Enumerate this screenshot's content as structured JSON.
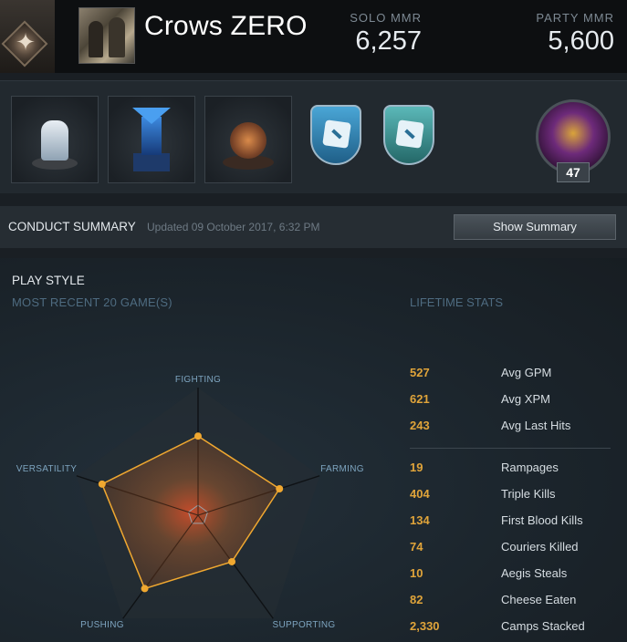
{
  "header": {
    "player_name": "Crows ZERO",
    "solo_mmr_label": "SOLO MMR",
    "solo_mmr_value": "6,257",
    "party_mmr_label": "PARTY MMR",
    "party_mmr_value": "5,600"
  },
  "trophies": {
    "items": [
      "trophy-white-dragon",
      "trophy-blue-tower",
      "trophy-bronze-crown",
      "dota-shield-blue",
      "dota-shield-teal"
    ],
    "hero_level": "47"
  },
  "conduct": {
    "title": "CONDUCT SUMMARY",
    "updated": "Updated 09 October 2017, 6:32 PM",
    "button_label": "Show Summary"
  },
  "playstyle": {
    "title": "PLAY STYLE",
    "subtitle": "MOST RECENT 20 GAME(S)",
    "lifetime_title": "LIFETIME STATS",
    "axes": [
      "FIGHTING",
      "FARMING",
      "SUPPORTING",
      "PUSHING",
      "VERSATILITY"
    ],
    "values": [
      0.62,
      0.67,
      0.45,
      0.71,
      0.79
    ]
  },
  "lifetime_stats": [
    {
      "value": "527",
      "label": "Avg GPM"
    },
    {
      "value": "621",
      "label": "Avg XPM"
    },
    {
      "value": "243",
      "label": "Avg Last Hits"
    },
    {
      "value": "19",
      "label": "Rampages"
    },
    {
      "value": "404",
      "label": "Triple Kills"
    },
    {
      "value": "134",
      "label": "First Blood Kills"
    },
    {
      "value": "74",
      "label": "Couriers Killed"
    },
    {
      "value": "10",
      "label": "Aegis Steals"
    },
    {
      "value": "82",
      "label": "Cheese Eaten"
    },
    {
      "value": "2,330",
      "label": "Camps Stacked"
    }
  ],
  "colors": {
    "accent": "#e0a43a",
    "radar_fill": "#b8622a",
    "radar_stroke": "#f0a830"
  }
}
